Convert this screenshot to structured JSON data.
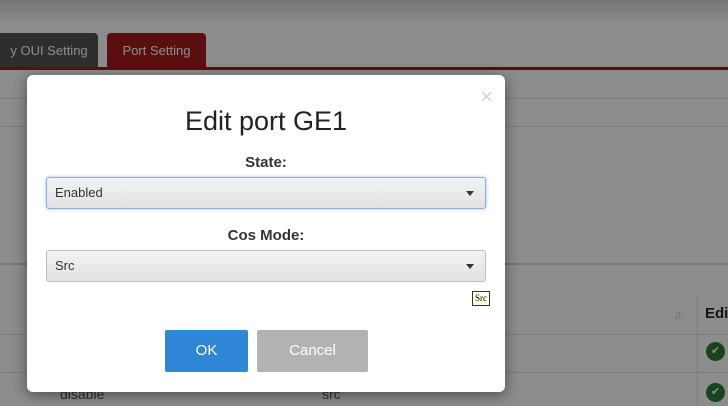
{
  "tabs": {
    "oui_label": "y OUI Setting",
    "port_label": "Port Setting"
  },
  "table": {
    "edit_header": "Edi",
    "sort_icon": "↓↑",
    "row_state": "disable",
    "row_cos": "src"
  },
  "modal": {
    "title": "Edit port GE1",
    "close_glyph": "×",
    "state_label": "State:",
    "state_value": "Enabled",
    "cos_label": "Cos Mode:",
    "cos_value": "Src",
    "tooltip_text": "Src",
    "ok_label": "OK",
    "cancel_label": "Cancel"
  },
  "icons": {
    "edit": "wrench-icon",
    "close": "close-icon",
    "sort": "sort-icon",
    "dropdown": "chevron-down-icon"
  },
  "colors": {
    "brand_red": "#a61b1b",
    "tab_dark": "#555555",
    "ok_blue": "#2f86d6",
    "cancel_gray": "#b2b2b2",
    "edit_green": "#2f7a38"
  }
}
